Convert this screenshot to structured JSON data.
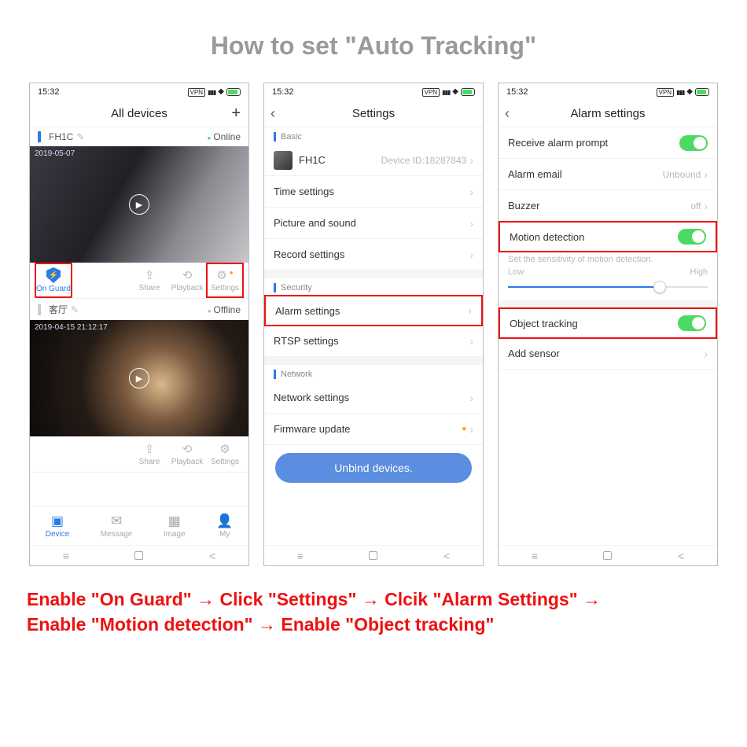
{
  "title": "How to set \"Auto Tracking\"",
  "status": {
    "time": "15:32",
    "vpn": "VPN"
  },
  "screen1": {
    "header": "All devices",
    "devices": [
      {
        "name": "FH1C",
        "status": "Online",
        "timestamp": "2019-05-07"
      },
      {
        "name": "客厅",
        "status": "Offline",
        "timestamp": "2019-04-15  21:12:17"
      }
    ],
    "actions": {
      "onguard": "On Guard",
      "share": "Share",
      "playback": "Playback",
      "settings": "Settings"
    },
    "tabs": {
      "device": "Device",
      "message": "Message",
      "image": "Image",
      "my": "My"
    }
  },
  "screen2": {
    "header": "Settings",
    "sections": {
      "basic": "Basic",
      "security": "Security",
      "network": "Network"
    },
    "device": {
      "name": "FH1C",
      "id_label": "Device ID:18287843"
    },
    "rows": {
      "time": "Time settings",
      "picture": "Picture and sound",
      "record": "Record settings",
      "alarm": "Alarm settings",
      "rtsp": "RTSP settings",
      "netset": "Network settings",
      "firmware": "Firmware update"
    },
    "unbind": "Unbind devices."
  },
  "screen3": {
    "header": "Alarm settings",
    "rows": {
      "receive": "Receive alarm prompt",
      "email": "Alarm email",
      "email_val": "Unbound",
      "buzzer": "Buzzer",
      "buzzer_val": "off",
      "motion": "Motion detection",
      "help": "Set the sensitivity of motion detection.",
      "low": "Low",
      "high": "High",
      "object": "Object tracking",
      "sensor": "Add sensor"
    }
  },
  "instructions_line1": "Enable \"On Guard\" → Click \"Settings\" → Clcik \"Alarm Settings\" →",
  "instructions_line2": "Enable \"Motion detection\" → Enable \"Object tracking\""
}
